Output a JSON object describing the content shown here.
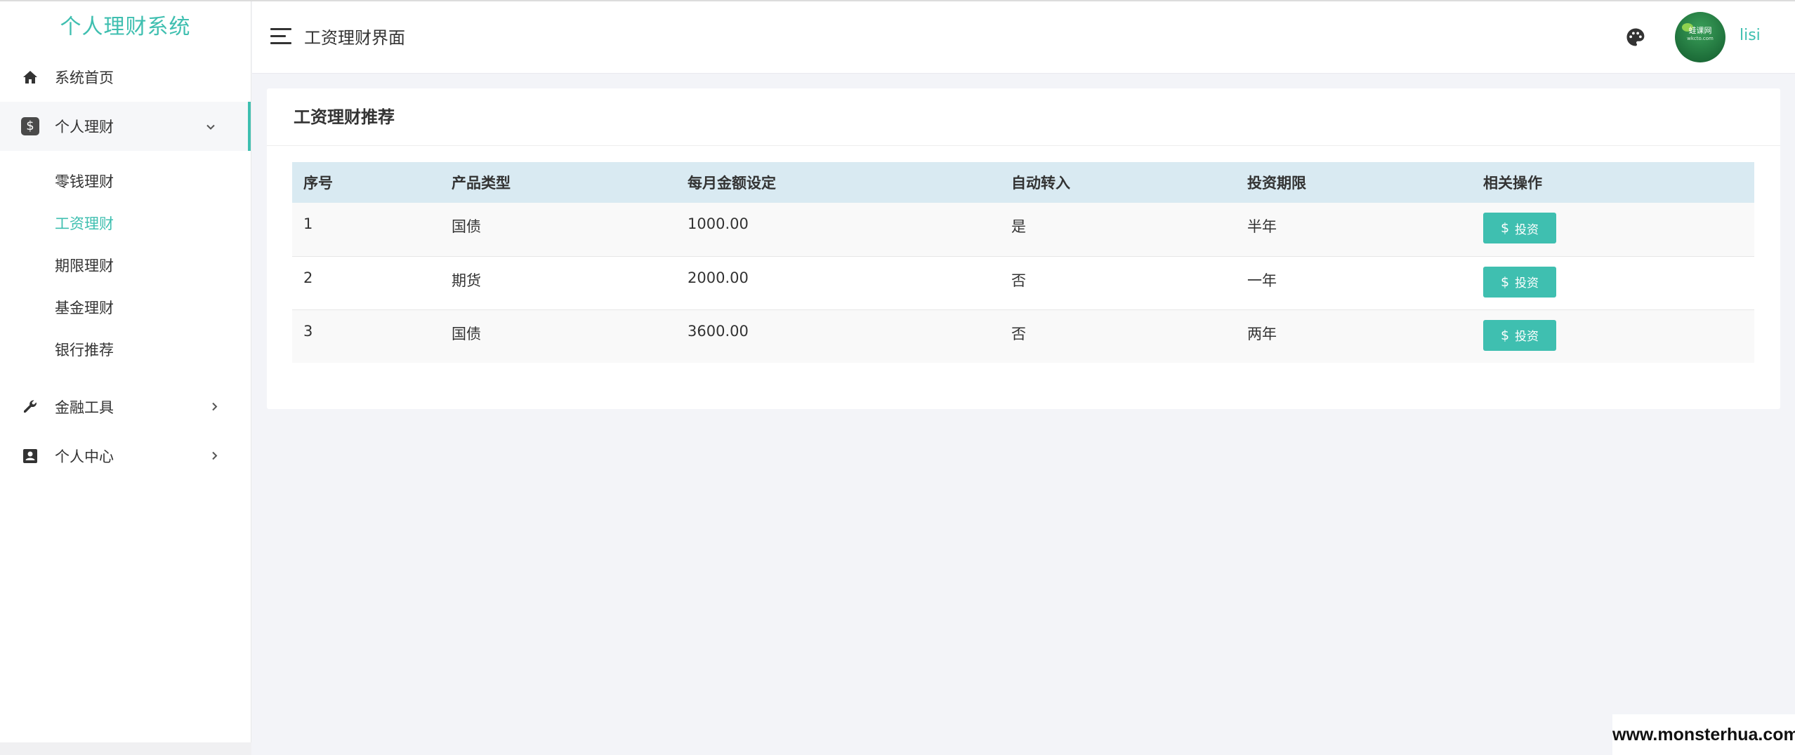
{
  "sidebar": {
    "brand": "个人理财系统",
    "items": [
      {
        "label": "系统首页",
        "icon": "home-icon"
      },
      {
        "label": "个人理财",
        "icon": "dollar-icon"
      },
      {
        "label": "金融工具",
        "icon": "wrench-icon"
      },
      {
        "label": "个人中心",
        "icon": "contact-card-icon"
      }
    ],
    "submenu": [
      {
        "label": "零钱理财"
      },
      {
        "label": "工资理财"
      },
      {
        "label": "期限理财"
      },
      {
        "label": "基金理财"
      },
      {
        "label": "银行推荐"
      }
    ],
    "active_submenu": "工资理财",
    "accent_color": "#3fbfb0"
  },
  "header": {
    "title": "工资理财界面",
    "username": "lisi",
    "avatar_text": "蛙课网",
    "avatar_subtext": "wkcto.com"
  },
  "card": {
    "title": "工资理财推荐",
    "columns": [
      "序号",
      "产品类型",
      "每月金额设定",
      "自动转入",
      "投资期限",
      "相关操作"
    ],
    "rows": [
      {
        "id": "1",
        "type": "国债",
        "amount": "1000.00",
        "auto": "是",
        "term": "半年",
        "action": "投资"
      },
      {
        "id": "2",
        "type": "期货",
        "amount": "2000.00",
        "auto": "否",
        "term": "一年",
        "action": "投资"
      },
      {
        "id": "3",
        "type": "国债",
        "amount": "3600.00",
        "auto": "否",
        "term": "两年",
        "action": "投资"
      }
    ]
  },
  "watermark": "www.monsterhua.com"
}
